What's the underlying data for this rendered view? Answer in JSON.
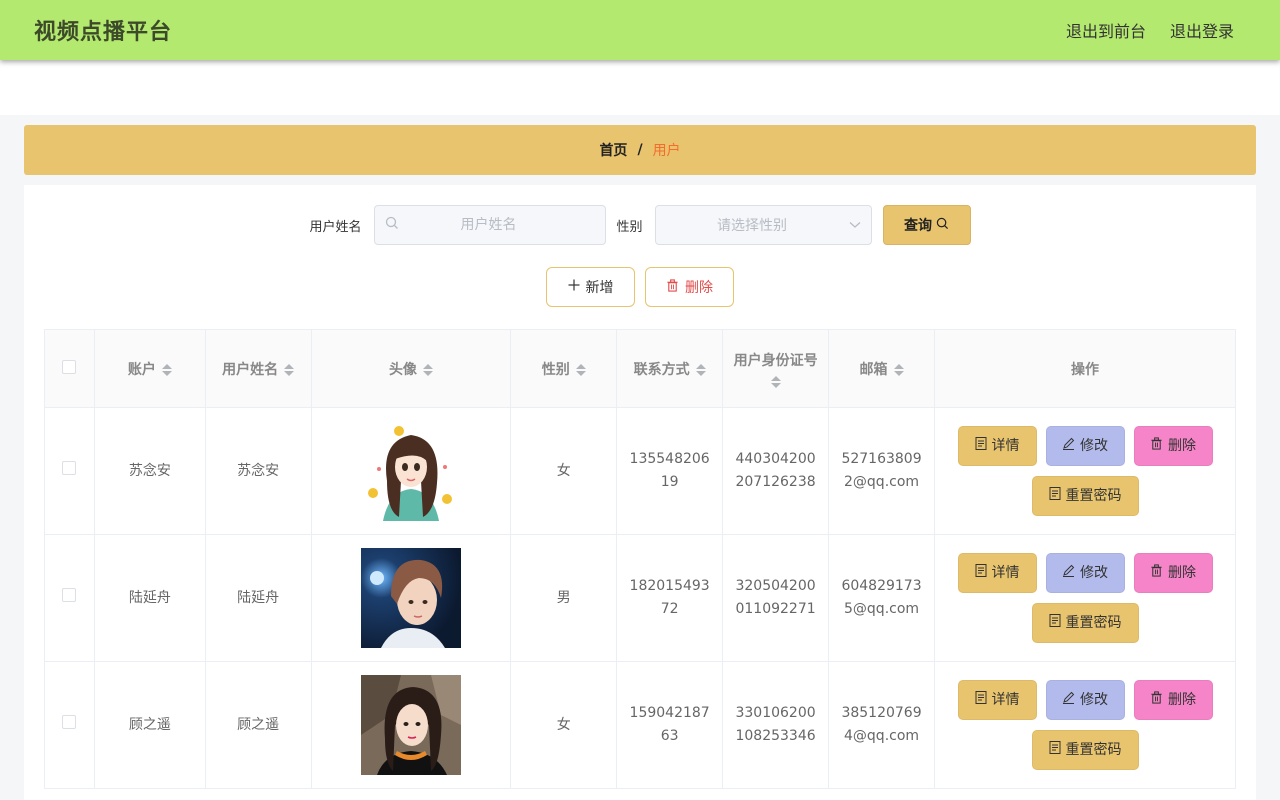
{
  "header": {
    "title": "视频点播平台",
    "link_front": "退出到前台",
    "link_logout": "退出登录"
  },
  "breadcrumb": {
    "home": "首页",
    "sep": "/",
    "current": "用户"
  },
  "search": {
    "name_label": "用户姓名",
    "name_placeholder": "用户姓名",
    "gender_label": "性别",
    "gender_placeholder": "请选择性别",
    "query_label": "查询"
  },
  "actions": {
    "add_label": "新增",
    "delete_label": "删除"
  },
  "table": {
    "columns": [
      "账户",
      "用户姓名",
      "头像",
      "性别",
      "联系方式",
      "用户身份证号",
      "邮箱",
      "操作"
    ],
    "rows": [
      {
        "account": "苏念安",
        "name": "苏念安",
        "avatar_icon": "cartoon-girl-avatar",
        "gender": "女",
        "phone": "13554820619",
        "id_card": "440304200207126238",
        "email": "5271638092@qq.com"
      },
      {
        "account": "陆延舟",
        "name": "陆延舟",
        "avatar_icon": "boy-photo-avatar",
        "gender": "男",
        "phone": "18201549372",
        "id_card": "320504200011092271",
        "email": "6048291735@qq.com"
      },
      {
        "account": "顾之遥",
        "name": "顾之遥",
        "avatar_icon": "girl-photo-avatar",
        "gender": "女",
        "phone": "15904218763",
        "id_card": "330106200108253346",
        "email": "3851207694@qq.com"
      }
    ],
    "op_detail": "详情",
    "op_edit": "修改",
    "op_delete": "删除",
    "op_reset": "重置密码"
  },
  "colors": {
    "topbar": "#b4e970",
    "accent": "#e8c46e",
    "edit": "#b3bbec",
    "delete": "#f585c8",
    "breadcrumb_current": "#f56c2c"
  }
}
